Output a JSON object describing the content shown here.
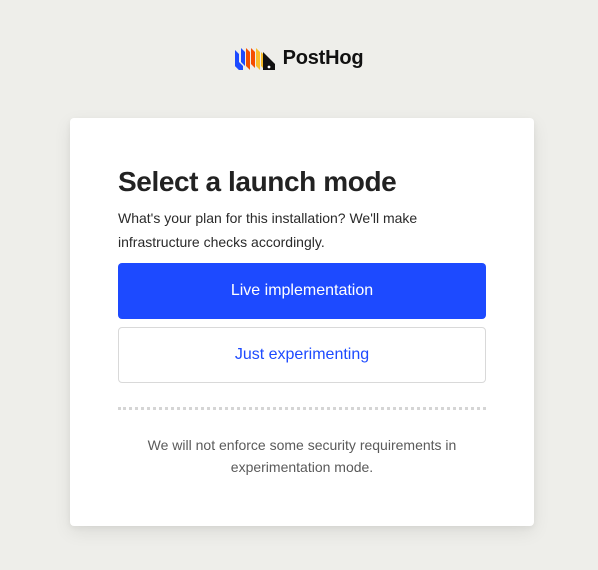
{
  "brand": {
    "name": "PostHog",
    "logo_icon": "posthog-hedgehog-logo",
    "colors": {
      "blue": "#1d4aff",
      "orange": "#f54e00",
      "yellow": "#f9bd2b",
      "black": "#111111"
    }
  },
  "card": {
    "title": "Select a launch mode",
    "subtitle": "What's your plan for this installation? We'll make infrastructure checks accordingly.",
    "primary_button_label": "Live implementation",
    "secondary_button_label": "Just experimenting",
    "footnote": "We will not enforce some security requirements in experimentation mode."
  },
  "colors": {
    "page_background": "#eeeeea",
    "card_background": "#ffffff",
    "accent": "#1d4aff"
  }
}
